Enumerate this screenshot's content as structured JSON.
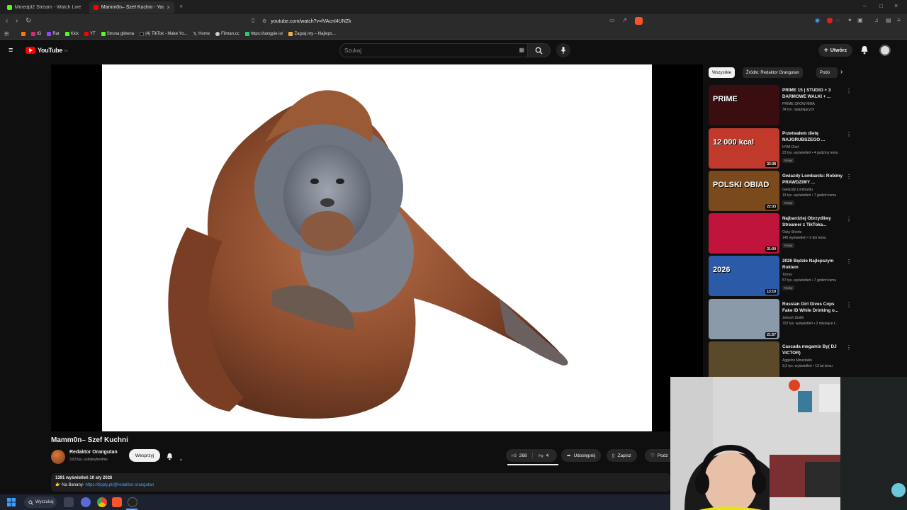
{
  "browser": {
    "tabs": [
      {
        "title": "Minedpl2 Stream - Watch Live on Ki",
        "active": false,
        "color": "#53fc18"
      },
      {
        "title": "Mamm0n– Szef Kuchni - YouTu",
        "active": true,
        "color": "#ff0000"
      }
    ],
    "url": "youtube.com/watch?v=lVAcnI4UNZk",
    "bookmarks": [
      "IG",
      "Rat",
      "Kick",
      "YT",
      "Strona główna",
      "(4) TikTok - Make Yo...",
      "Home",
      "Filman.cc",
      "https://tangpie.io/",
      "Zagraj.my – Najleps..."
    ]
  },
  "youtube": {
    "logo_text": "YouTube",
    "logo_region": "PL",
    "search_placeholder": "Szukaj",
    "create_label": "Utwórz"
  },
  "video": {
    "title": "Mamm0n– Szef Kuchni",
    "channel_name": "Redaktor Orangutan",
    "channel_subs": "3,63 tys. subskrybentów",
    "support_label": "Wesprzyj",
    "likes": "268",
    "dislikes": "4",
    "share_label": "Udostępnij",
    "save_label": "Zapisz",
    "thanks_label": "Podz",
    "views_date": "1391 wyświetleń  10 sty 2026",
    "desc_prefix": "👉 Na Banany- ",
    "desc_link": "https://tipply.pl/@redaktor-orangutan"
  },
  "sidebar": {
    "chips": [
      "Wszystkie",
      "Źródło: Redaktor Orangutan",
      "Podo"
    ],
    "recommendations": [
      {
        "title": "PRIME 15 | STUDIO + 3 DARMOWE WALKI + ...",
        "channel": "PRIME SHOW MMA",
        "meta": "34 tys. oglądających",
        "badge": "",
        "duration": "",
        "thumb_bg": "#3a0d10",
        "thumb_text": "PRIME"
      },
      {
        "title": "Przetwałem dietę NAJGRUBSZEGO ...",
        "channel": "HYM Chef",
        "meta": "23 tys. wyświetleń • 4 godziny temu",
        "badge": "Nowy",
        "duration": "33:38",
        "thumb_bg": "#c0392b",
        "thumb_text": "12 000 kcal"
      },
      {
        "title": "Gwiazdy Lombardu: Robimy PRAWDZIWY ...",
        "channel": "Gwiazdy Lombardu",
        "meta": "19 tys. wyświetleń • 7 godzin temu",
        "badge": "Nowy",
        "duration": "22:33",
        "thumb_bg": "#7a4a1c",
        "thumb_text": "POLSKI OBIAD"
      },
      {
        "title": "Najbardziej Obrzydliwy Streamer z TikToka...",
        "channel": "Osky Shorts",
        "meta": "140 wyświetleń • 3 dni temu",
        "badge": "Nowy",
        "duration": "31:00",
        "thumb_bg": "#c0143c",
        "thumb_text": ""
      },
      {
        "title": "2026 Będzie Najlepszym Rokiem",
        "channel": "Torres",
        "meta": "57 tys. wyświetleń • 7 godzin temu",
        "badge": "Nowy",
        "duration": "13:10",
        "thumb_bg": "#2a5aa8",
        "thumb_text": "2026"
      },
      {
        "title": "Russian Girl Gives Cops Fake ID While Drinking o...",
        "channel": "Johnch Smith",
        "meta": "702 tys. wyświetleń • 2 miesiące t...",
        "badge": "",
        "duration": "21:57",
        "thumb_bg": "#8a9aa8",
        "thumb_text": ""
      },
      {
        "title": "Cascada megamix By( DJ VICTOR)",
        "channel": "Aggelos Moustakis",
        "meta": "3,3 tys. wyświetleń • 13 lat temu",
        "badge": "",
        "duration": "",
        "thumb_bg": "#5a4a2a",
        "thumb_text": ""
      }
    ]
  },
  "taskbar": {
    "search_label": "Wyszukaj"
  }
}
